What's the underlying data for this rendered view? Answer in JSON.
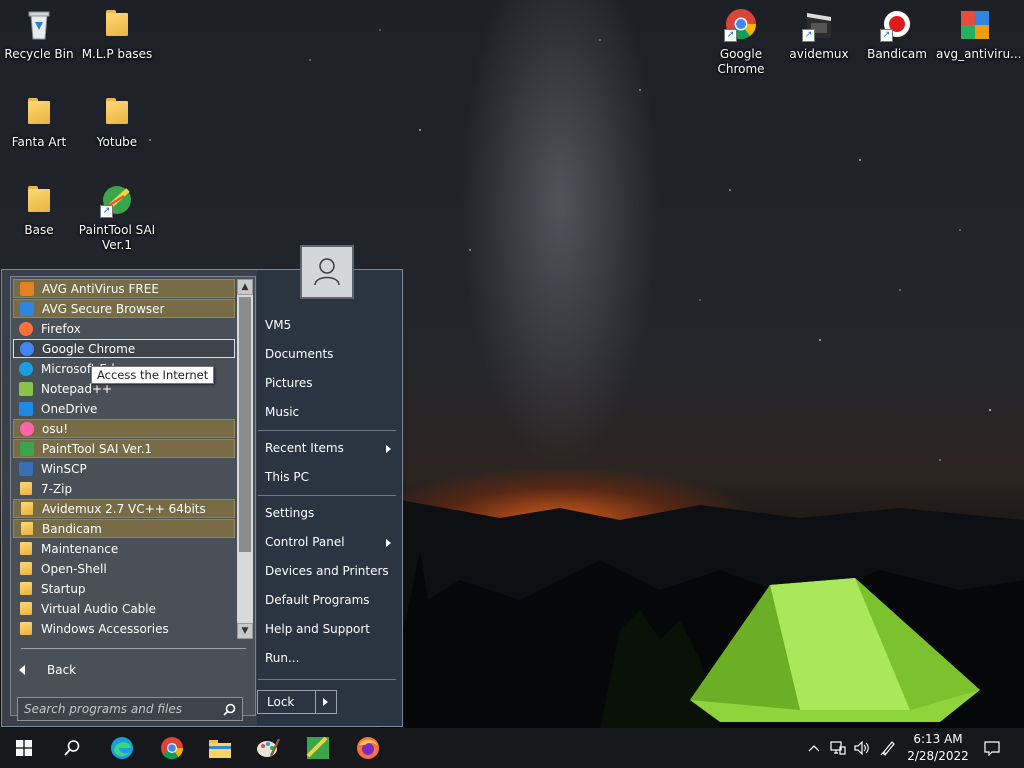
{
  "desktop": {
    "left_icons": [
      {
        "label": "Recycle Bin",
        "icon": "recycle-bin-icon"
      },
      {
        "label": "M.L.P bases",
        "icon": "folder-icon"
      },
      {
        "label": "Fanta Art",
        "icon": "folder-icon"
      },
      {
        "label": "Yotube",
        "icon": "folder-icon"
      },
      {
        "label": "Base",
        "icon": "folder-icon"
      },
      {
        "label": "PaintTool SAI Ver.1",
        "icon": "painttool-sai-icon"
      }
    ],
    "right_icons": [
      {
        "label": "Google Chrome",
        "icon": "chrome-icon"
      },
      {
        "label": "avidemux",
        "icon": "avidemux-icon"
      },
      {
        "label": "Bandicam",
        "icon": "bandicam-icon"
      },
      {
        "label": "avg_antiviru...",
        "icon": "avg-icon"
      }
    ]
  },
  "start_menu": {
    "programs": [
      {
        "label": "AVG AntiVirus FREE",
        "icon": "avg-icon",
        "highlighted": true
      },
      {
        "label": "AVG Secure Browser",
        "icon": "avg-browser-icon",
        "highlighted": true
      },
      {
        "label": "Firefox",
        "icon": "firefox-icon",
        "highlighted": false
      },
      {
        "label": "Google Chrome",
        "icon": "chrome-icon",
        "highlighted": false,
        "selected": true
      },
      {
        "label": "Microsoft Edge",
        "icon": "edge-icon",
        "highlighted": false
      },
      {
        "label": "Notepad++",
        "icon": "notepadpp-icon",
        "highlighted": false
      },
      {
        "label": "OneDrive",
        "icon": "onedrive-icon",
        "highlighted": false
      },
      {
        "label": "osu!",
        "icon": "osu-icon",
        "highlighted": true
      },
      {
        "label": "PaintTool SAI Ver.1",
        "icon": "painttool-sai-icon",
        "highlighted": true
      },
      {
        "label": "WinSCP",
        "icon": "winscp-icon",
        "highlighted": false
      },
      {
        "label": "7-Zip",
        "icon": "folder-icon",
        "highlighted": false
      },
      {
        "label": "Avidemux 2.7 VC++ 64bits",
        "icon": "folder-icon",
        "highlighted": true
      },
      {
        "label": "Bandicam",
        "icon": "folder-icon",
        "highlighted": true
      },
      {
        "label": "Maintenance",
        "icon": "folder-icon",
        "highlighted": false
      },
      {
        "label": "Open-Shell",
        "icon": "folder-icon",
        "highlighted": false
      },
      {
        "label": "Startup",
        "icon": "folder-icon",
        "highlighted": false
      },
      {
        "label": "Virtual Audio Cable",
        "icon": "folder-icon",
        "highlighted": false
      },
      {
        "label": "Windows Accessories",
        "icon": "folder-icon",
        "highlighted": false
      }
    ],
    "tooltip": "Access the Internet",
    "back_label": "Back",
    "search_placeholder": "Search programs and files",
    "right_items": [
      {
        "label": "VM5",
        "has_submenu": false
      },
      {
        "label": "Documents",
        "has_submenu": false
      },
      {
        "label": "Pictures",
        "has_submenu": false
      },
      {
        "label": "Music",
        "has_submenu": false
      },
      {
        "label": "Recent Items",
        "has_submenu": true
      },
      {
        "label": "This PC",
        "has_submenu": false
      },
      {
        "label": "Settings",
        "has_submenu": false
      },
      {
        "label": "Control Panel",
        "has_submenu": true
      },
      {
        "label": "Devices and Printers",
        "has_submenu": false
      },
      {
        "label": "Default Programs",
        "has_submenu": false
      },
      {
        "label": "Help and Support",
        "has_submenu": false
      },
      {
        "label": "Run...",
        "has_submenu": false
      }
    ],
    "lock_label": "Lock"
  },
  "taskbar": {
    "pinned": [
      "windows-start-icon",
      "search-icon",
      "edge-icon",
      "chrome-icon",
      "file-explorer-icon",
      "paint-icon",
      "painttool-sai-icon",
      "firefox-icon"
    ],
    "tray_icons": [
      "chevron-up-icon",
      "network-icon",
      "volume-icon",
      "pen-icon"
    ],
    "time": "6:13 AM",
    "date": "2/28/2022",
    "notification_icon": "action-center-icon"
  },
  "colors": {
    "start_highlight": "#776c45",
    "start_bg": "#3a4049",
    "right_pane_bg": "#2a3541",
    "taskbar_bg": "#16181c"
  }
}
